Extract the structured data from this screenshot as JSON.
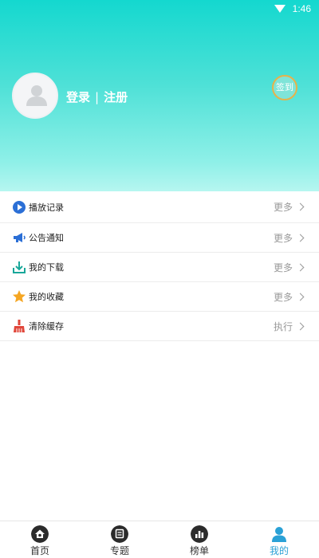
{
  "status_bar": {
    "time": "1:46"
  },
  "header": {
    "login_label": "登录",
    "separator": "|",
    "register_label": "注册",
    "checkin_label": "签到"
  },
  "menu": {
    "items": [
      {
        "label": "播放记录",
        "action": "更多",
        "icon": "play-circle-icon"
      },
      {
        "label": "公告通知",
        "action": "更多",
        "icon": "megaphone-icon"
      },
      {
        "label": "我的下载",
        "action": "更多",
        "icon": "download-icon"
      },
      {
        "label": "我的收藏",
        "action": "更多",
        "icon": "star-icon"
      },
      {
        "label": "清除缓存",
        "action": "执行",
        "icon": "broom-icon"
      }
    ]
  },
  "tabbar": {
    "tabs": [
      {
        "label": "首页",
        "icon": "home-icon"
      },
      {
        "label": "专题",
        "icon": "topic-icon"
      },
      {
        "label": "榜单",
        "icon": "ranking-icon"
      },
      {
        "label": "我的",
        "icon": "user-icon",
        "active": true
      }
    ]
  },
  "colors": {
    "header_gradient_top": "#14d8cf",
    "header_gradient_bottom": "#b6f6f0",
    "active_tab": "#2aa1d6",
    "checkin_ring": "#e7b24a"
  }
}
